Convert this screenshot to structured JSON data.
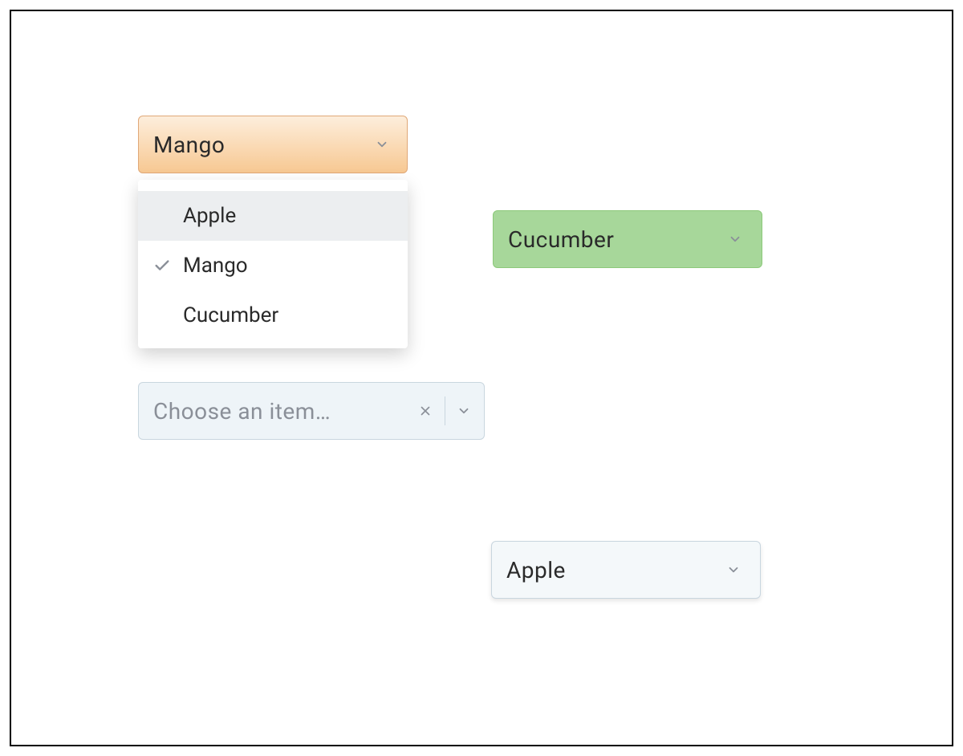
{
  "combobox1": {
    "selected": "Mango",
    "options": [
      "Apple",
      "Mango",
      "Cucumber"
    ],
    "highlighted_index": 0,
    "selected_index": 1
  },
  "combobox2": {
    "selected": "Cucumber"
  },
  "combobox3": {
    "placeholder": "Choose an item…"
  },
  "combobox4": {
    "selected": "Apple"
  }
}
